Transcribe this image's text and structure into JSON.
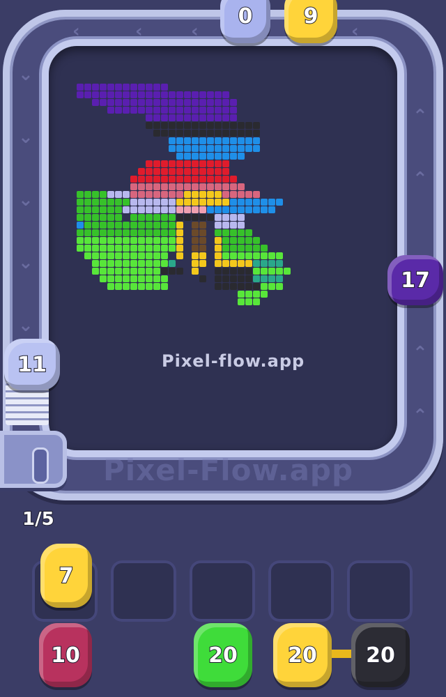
{
  "watermarks": {
    "board": "Pixel-flow.app",
    "track": "Pixel-Flow.app"
  },
  "queue_counter": "1/5",
  "track_pigs": [
    {
      "id": "top-left",
      "count": "0",
      "color": "#a9b3ee"
    },
    {
      "id": "top-right",
      "count": "9",
      "color": "#ffd43a"
    },
    {
      "id": "right",
      "count": "17",
      "color": "#5a2aa8"
    },
    {
      "id": "left",
      "count": "11",
      "color": "#b9c2f2"
    }
  ],
  "holding_slots": [
    {
      "count": "7",
      "color": "#ffd43a"
    },
    {
      "count": "",
      "color": ""
    },
    {
      "count": "",
      "color": ""
    },
    {
      "count": "",
      "color": ""
    },
    {
      "count": "",
      "color": ""
    }
  ],
  "queue_pigs": [
    {
      "count": "10",
      "color": "#b8325e"
    },
    {
      "count": "20",
      "color": "#3fdc3a"
    },
    {
      "count": "20",
      "color": "#ffd43a"
    },
    {
      "count": "20",
      "color": "#2c2c34"
    }
  ],
  "pixel_palette": {
    "purple": "#5a1fb0",
    "black": "#2a2a30",
    "blue": "#1f8fe8",
    "red": "#e01c2c",
    "pink": "#d8667e",
    "lilac": "#b8b8ee",
    "green": "#37c12a",
    "lime": "#58e63a",
    "yellow": "#f4c81c",
    "brown": "#6b4a2a",
    "peach": "#f0a0b0",
    "teal": "#2aa88a"
  }
}
